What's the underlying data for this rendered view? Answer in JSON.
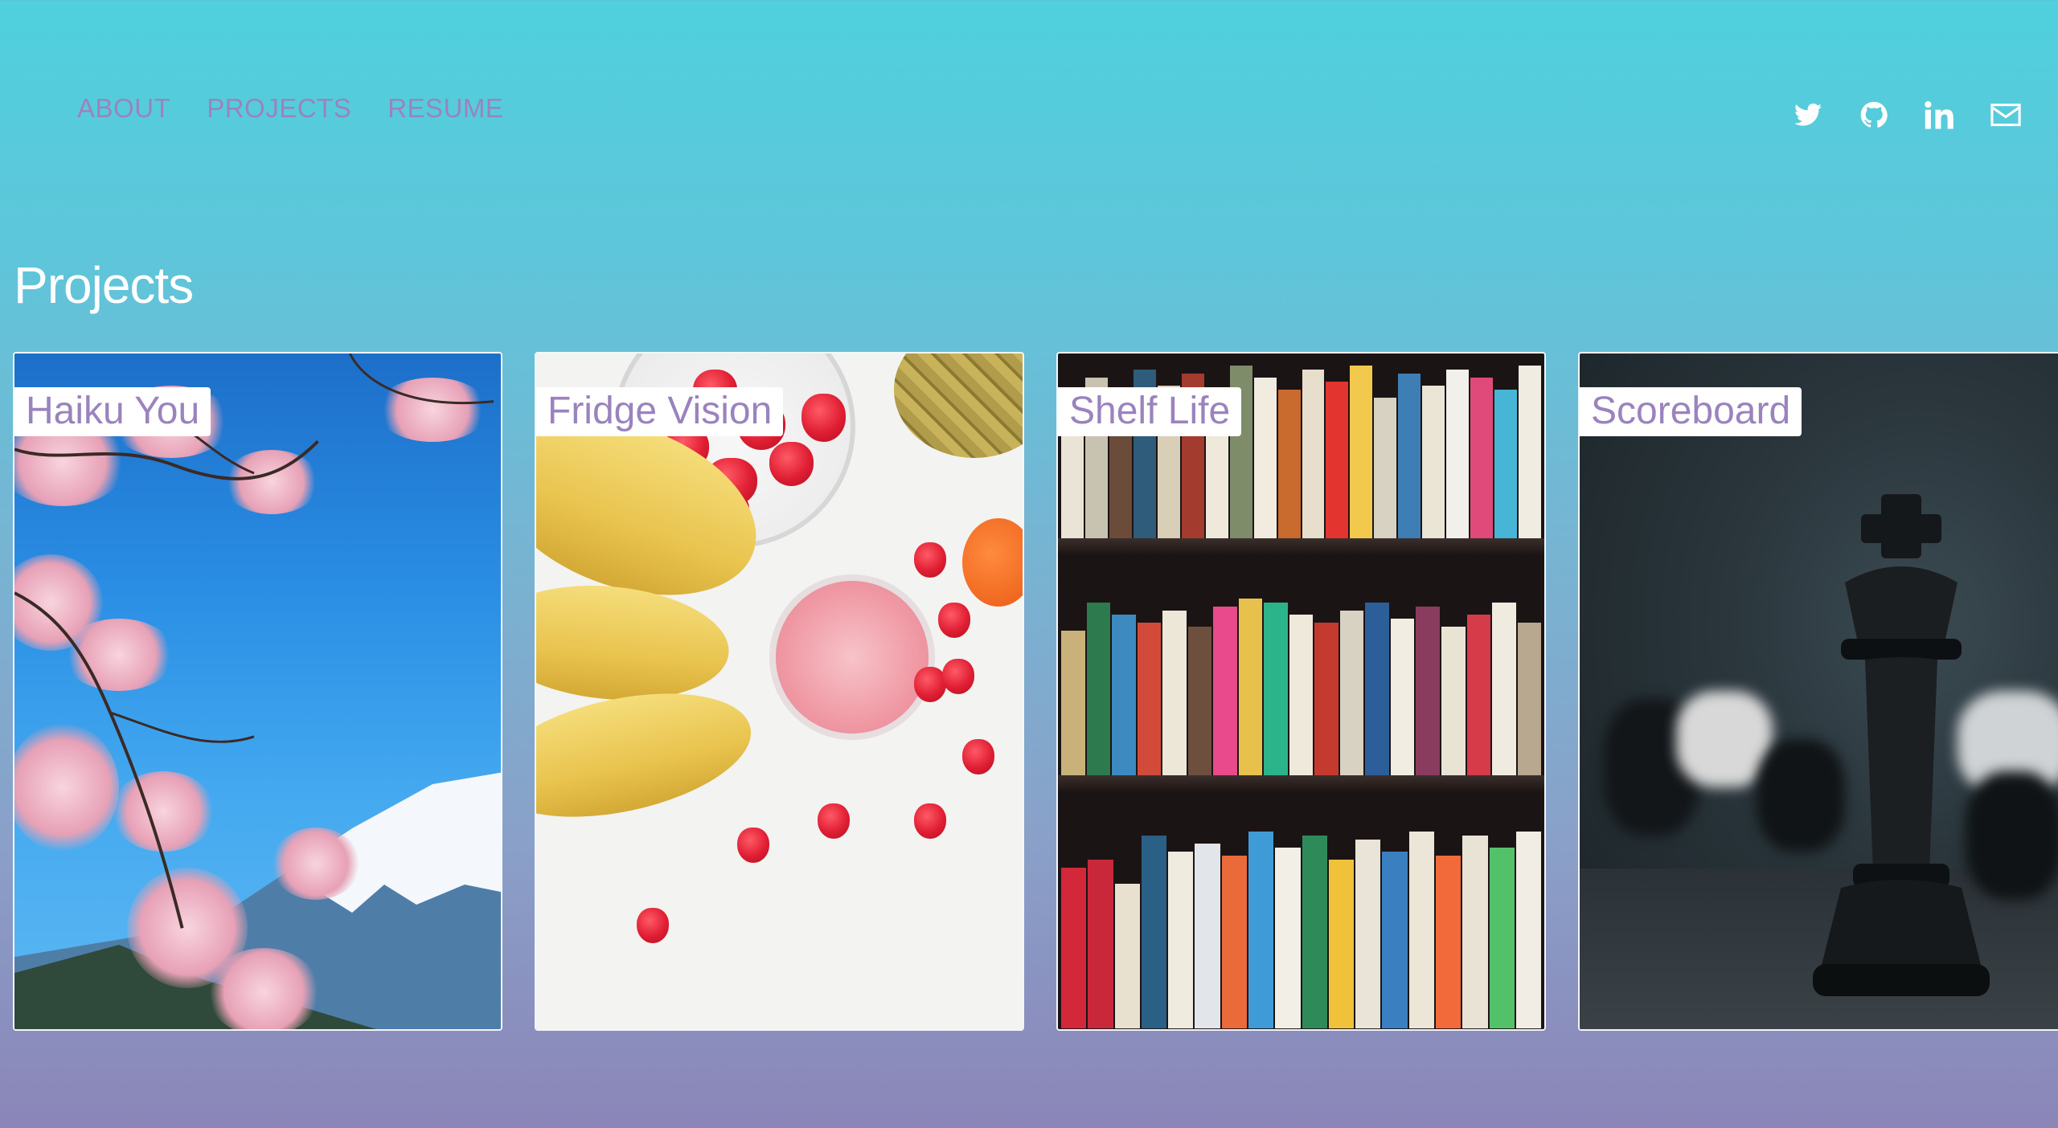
{
  "nav": {
    "links": [
      {
        "label": "ABOUT"
      },
      {
        "label": "PROJECTS"
      },
      {
        "label": "RESUME"
      }
    ]
  },
  "social": {
    "icons": [
      "twitter-icon",
      "github-icon",
      "linkedin-icon",
      "mail-icon"
    ],
    "linkedin_text": "in"
  },
  "page": {
    "title": "Projects"
  },
  "projects": [
    {
      "title": "Haiku You",
      "image": "cherry blossoms and mountain"
    },
    {
      "title": "Fridge Vision",
      "image": "fruit and smoothie"
    },
    {
      "title": "Shelf Life",
      "image": "bookshelf"
    },
    {
      "title": "Scoreboard",
      "image": "chess king"
    }
  ],
  "colors": {
    "accent": "#9a83bd",
    "background_top": "#4fd0dc",
    "background_bottom": "#8b85b8"
  }
}
